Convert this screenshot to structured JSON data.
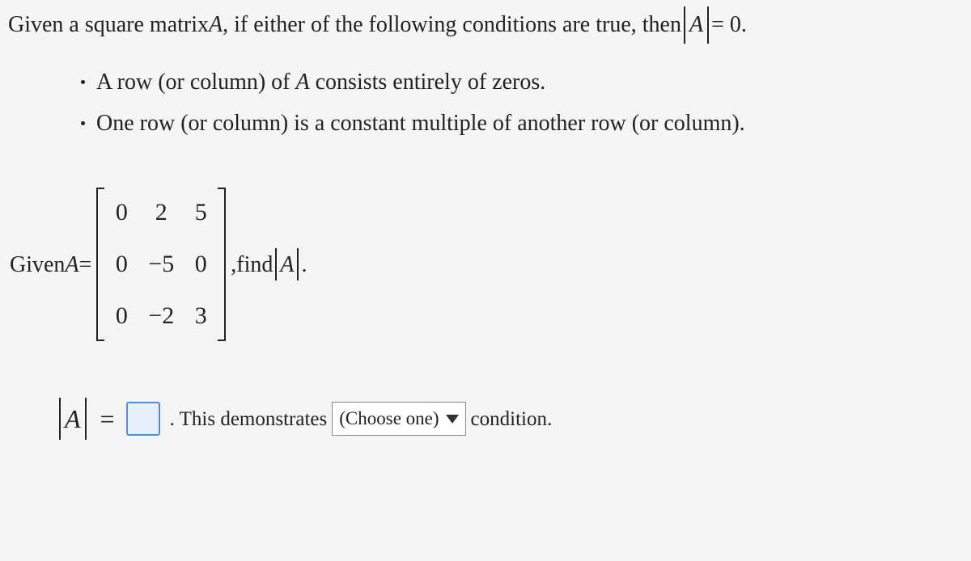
{
  "intro": {
    "part1": "Given a square matrix ",
    "var1": "A",
    "part2": ", if either of the following conditions are true, then ",
    "detVar": "A",
    "eqZero": " = 0."
  },
  "bullets": {
    "b1_p1": "A row (or column) of ",
    "b1_var": "A",
    "b1_p2": " consists entirely of zeros.",
    "b2": "One row (or column) is a constant multiple of another row (or column)."
  },
  "problem": {
    "givenLabel": "Given ",
    "varA": "A",
    "eq": " = ",
    "m": [
      [
        "0",
        "2",
        "5"
      ],
      [
        "0",
        "−5",
        "0"
      ],
      [
        "0",
        "−2",
        "3"
      ]
    ],
    "comma": ", ",
    "findLabel": "find ",
    "detVar": "A",
    "period": "."
  },
  "answer": {
    "detVar": "A",
    "eq": "=",
    "textBefore": ". This demonstrates",
    "dropdown": "(Choose one)",
    "textAfter": "condition."
  }
}
